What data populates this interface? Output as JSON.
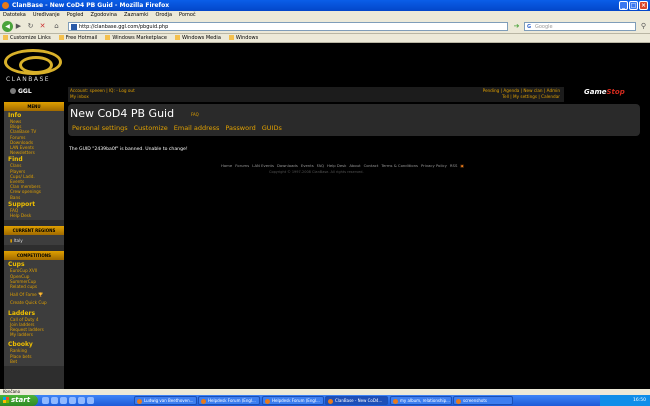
{
  "window": {
    "title": "ClanBase - New CoD4 PB Guid - Mozilla Firefox"
  },
  "menu": [
    "Datoteka",
    "Uređivanje",
    "Pogled",
    "Zgodovina",
    "Zaznamki",
    "Orodja",
    "Pomoč"
  ],
  "nav": {
    "url": "http://clanbase.ggl.com/pbguid.php",
    "search_placeholder": "Google"
  },
  "bookmarks": [
    "Customize Links",
    "Free Hotmail",
    "Windows Marketplace",
    "Windows Media",
    "Windows"
  ],
  "site": {
    "logo_text": "CLANBASE",
    "ggl_text": "GGL",
    "sponsor": {
      "a": "Game",
      "b": "Stop"
    }
  },
  "topbar": {
    "left_line1": "Account: speeen | IQ: - Log out",
    "left_line2": "My inbox",
    "right_line1": "Pending | Agenda | New clan | Admin",
    "right_line2": "Tell | My settings | Calendar"
  },
  "sidebar": {
    "menu_header": "MENU",
    "info_title": "Info",
    "info_links": [
      "News",
      "Blogs",
      "ClanBase TV",
      "Forums",
      "Downloads",
      "LAN Events",
      "Newsletters"
    ],
    "find_title": "Find",
    "find_links": [
      "Clans",
      "Players",
      "Cups/ Ladd.",
      "Events",
      "Clan members",
      "Crew openings",
      "Bans"
    ],
    "support_title": "Support",
    "support_links": [
      "FAQ",
      "Help Desk"
    ],
    "regions_header": "CURRENT REGIONS",
    "region": "Italy",
    "competitions_header": "COMPETITIONS",
    "cups_title": "Cups",
    "cups_links": [
      "EuroCup XVII",
      "OpenCup",
      "SummerCup",
      "Related cups"
    ],
    "hall_of_fame": "Hall Of Fame",
    "create_cup": "Create Quick Cup",
    "ladders_title": "Ladders",
    "ladders_links": [
      "Call of Duty 4",
      "Join ladders",
      "Request ladders",
      "My ladders"
    ],
    "cbooky_title": "Cbooky",
    "cbooky_links": [
      "Ranking",
      "Place bets",
      "Bet"
    ]
  },
  "main": {
    "title": "New CoD4 PB Guid",
    "faq": "FAQ",
    "tabs": [
      "Personal settings",
      "Customize",
      "Email address",
      "Password",
      "GUIDs"
    ],
    "message": "The GUID \"2439ba0f\" is banned. Unable to change!"
  },
  "footer": {
    "links": [
      "Home",
      "Forums",
      "LAN Events",
      "Downloads",
      "Events",
      "FAQ",
      "Help Desk",
      "About",
      "Contact",
      "Terms & Conditions",
      "Privacy Policy",
      "RSS"
    ],
    "copyright": "Copyright © 1997-2008 ClanBase. All rights reserved."
  },
  "statusbar": {
    "text": "Končano"
  },
  "taskbar": {
    "start": "start",
    "tasks": [
      "Ludwig van Beethoven...",
      "Helpdesk Forum (Engl...",
      "Helpdesk Forum (Engl...",
      "ClanBase - New CoD4...",
      "my album, relationship...",
      "screenshots"
    ],
    "clock": "16:50"
  }
}
